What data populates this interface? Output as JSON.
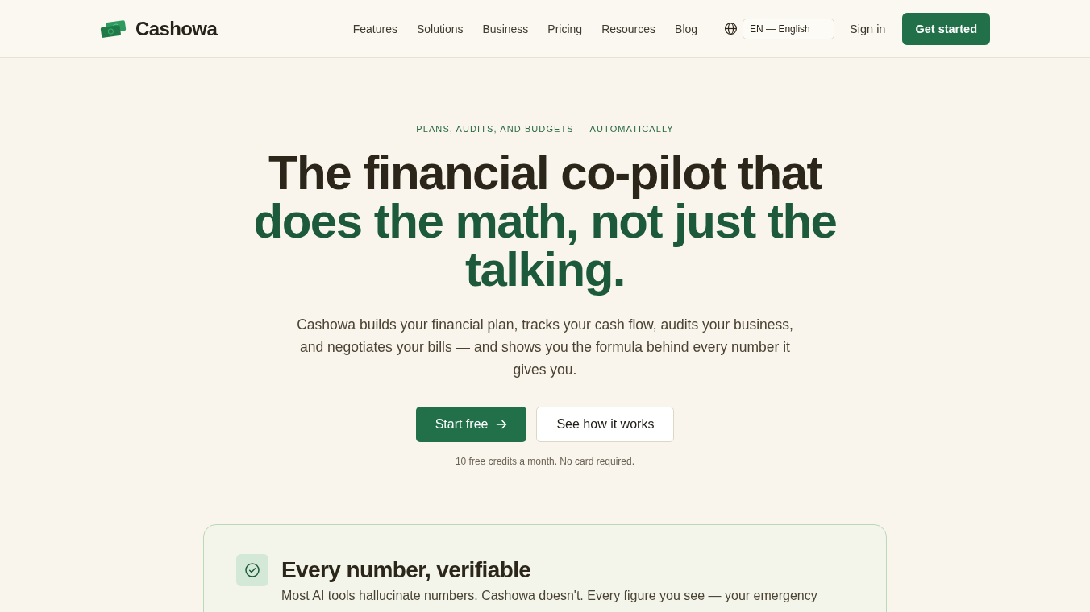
{
  "nav": {
    "brand": "Cashowa",
    "links": [
      "Features",
      "Solutions",
      "Business",
      "Pricing",
      "Resources",
      "Blog"
    ],
    "language": {
      "value": "EN — English"
    },
    "sign_in": "Sign in",
    "cta": "Get started"
  },
  "hero": {
    "eyebrow": "PLANS, AUDITS, AND BUDGETS — AUTOMATICALLY",
    "title": "The financial co-pilot that",
    "title_highlight": "does the math, not just the talking.",
    "subtitle": "Cashowa builds your financial plan, tracks your cash flow, audits your business, and negotiates your bills — and shows you the formula behind every number it gives you.",
    "buttons": [
      {
        "label": "Start free",
        "kind": "primary"
      },
      {
        "label": "See how it works",
        "kind": "secondary"
      }
    ],
    "note": "10 free credits a month. No card required."
  },
  "feature_card": {
    "title": "Every number, verifiable",
    "body": "Most AI tools hallucinate numbers. Cashowa doesn't. Every figure you see — your emergency"
  }
}
